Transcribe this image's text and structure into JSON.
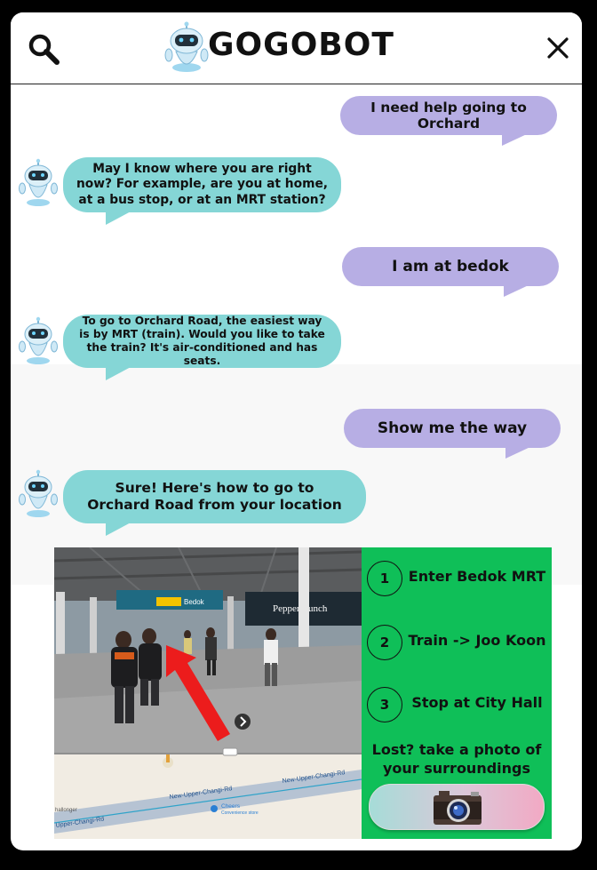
{
  "header": {
    "brand": "GOGOBOT",
    "icons": {
      "search": "search-icon",
      "close": "close-icon",
      "logo": "robot-logo-icon"
    }
  },
  "messages": [
    {
      "sender": "user",
      "text": "I need help going to Orchard"
    },
    {
      "sender": "bot",
      "text": "May I know where you are right now? For example, are you at home, at a bus stop, or at an MRT station?"
    },
    {
      "sender": "user",
      "text": "I am at bedok"
    },
    {
      "sender": "bot",
      "text": "To go to Orchard Road, the easiest way is by MRT (train). Would you like to take the train? It's air-conditioned and has seats."
    },
    {
      "sender": "user",
      "text": "Show me the way"
    },
    {
      "sender": "bot",
      "text": "Sure! Here's how to go to Orchard Road from your location"
    }
  ],
  "streetview": {
    "station_sign": "Bedok",
    "shop_sign": "Pepper Lunch",
    "map_labels": {
      "road_top": "New-Upper-Changi-Rd",
      "road_mid": "New-Upper-Changi-Rd",
      "road_left": "Upper-Changi-Rd",
      "store_name": "Cheers",
      "store_type": "Convenience store",
      "left_edge": "hallonger"
    }
  },
  "directions": {
    "steps": [
      {
        "number": "1",
        "text": "Enter Bedok MRT"
      },
      {
        "number": "2",
        "text": "Train -> Joo Koon"
      },
      {
        "number": "3",
        "text": "Stop at City Hall"
      }
    ],
    "lost_line1": "Lost? take a photo of",
    "lost_line2": "your surroundings",
    "camera_icon": "camera-icon"
  },
  "colors": {
    "user_bubble": "#b7aee4",
    "bot_bubble": "#85d6d6",
    "directions_panel": "#0fbf58"
  }
}
